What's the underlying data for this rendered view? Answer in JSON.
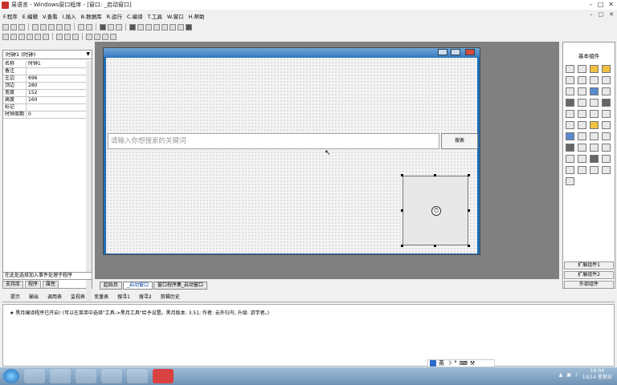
{
  "window": {
    "title": "易语言 - Windows窗口程序 - [窗口: _启动窗口]"
  },
  "menubar": {
    "items": [
      "F.程序",
      "E.编辑",
      "V.查看",
      "I.插入",
      "B.数据库",
      "R.运行",
      "C.编译",
      "T.工具",
      "W.窗口",
      "H.帮助"
    ]
  },
  "properties": {
    "combo_label": "时钟1 (时钟)",
    "rows": [
      {
        "key": "名称",
        "value": "时钟1"
      },
      {
        "key": "备注",
        "value": ""
      },
      {
        "key": "左边",
        "value": "696"
      },
      {
        "key": "顶边",
        "value": "280"
      },
      {
        "key": "宽度",
        "value": "152"
      },
      {
        "key": "高度",
        "value": "160"
      },
      {
        "key": "标记",
        "value": ""
      },
      {
        "key": "时钟周期",
        "value": "0"
      }
    ],
    "event_combo": "在此处选择加入事件处理子程序",
    "tabs": [
      "支持库",
      "程序",
      "属性"
    ]
  },
  "form": {
    "search_placeholder": "请输入你想搜索的关键词",
    "search_button": "搜索"
  },
  "palette": {
    "title": "基本组件",
    "tabs": [
      "扩展组件1",
      "扩展组件2",
      "外部组件"
    ]
  },
  "doc_tabs": [
    "起始页",
    "_启动窗口",
    "窗口程序集_启动窗口"
  ],
  "output": {
    "tabs": [
      "提示",
      "输出",
      "调用表",
      "监视表",
      "变量表",
      "搜寻1",
      "搜寻2",
      "剪辑历史"
    ],
    "message": "★ 黑月编译程序已开启! (可以在菜单中选择\"工具->黑月工具\"给予设置。黑月版本: 3.51; 作者: 云外归鸟; 升级: 游学者。)"
  },
  "ime": {
    "label": "英"
  },
  "taskbar": {
    "time": "16:04",
    "date": "10/14 星期日"
  }
}
